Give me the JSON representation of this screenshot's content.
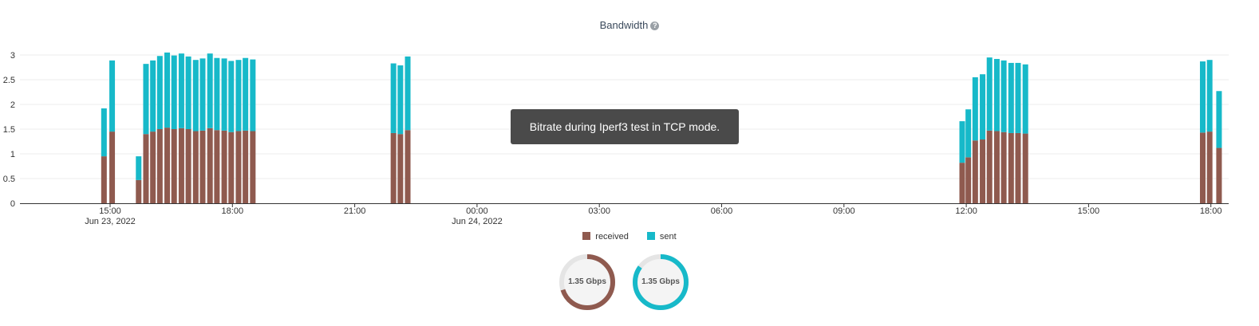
{
  "header": {
    "title": "Bandwidth",
    "help_icon": "question-circle-icon"
  },
  "tooltip": {
    "text": "Bitrate during Iperf3 test in TCP mode."
  },
  "colors": {
    "received": "#8f5a4f",
    "sent": "#17b9c9",
    "gauge_track": "#e5e5e5",
    "gauge_fill": "#f4f4f4"
  },
  "chart_data": {
    "type": "bar",
    "stacked": true,
    "ylim": [
      0,
      3
    ],
    "y_ticks": [
      "0",
      "0.5",
      "1",
      "1.5",
      "2",
      "2.5",
      "3"
    ],
    "x_ticks": [
      {
        "label": "15:00",
        "sub": "Jun 23, 2022"
      },
      {
        "label": "18:00",
        "sub": ""
      },
      {
        "label": "21:00",
        "sub": ""
      },
      {
        "label": "00:00",
        "sub": "Jun 24, 2022"
      },
      {
        "label": "03:00",
        "sub": ""
      },
      {
        "label": "06:00",
        "sub": ""
      },
      {
        "label": "09:00",
        "sub": ""
      },
      {
        "label": "12:00",
        "sub": ""
      },
      {
        "label": "15:00",
        "sub": ""
      },
      {
        "label": "18:00",
        "sub": ""
      }
    ],
    "x_hours": [
      14.85,
      15.05,
      15.7,
      15.88,
      16.05,
      16.22,
      16.4,
      16.57,
      16.75,
      16.92,
      17.1,
      17.27,
      17.45,
      17.62,
      17.8,
      17.97,
      18.15,
      18.32,
      18.5,
      21.95,
      22.12,
      22.3,
      35.9,
      36.05,
      36.22,
      36.4,
      36.57,
      36.75,
      36.92,
      37.1,
      37.27,
      37.45,
      41.8,
      41.97,
      42.2
    ],
    "series": [
      {
        "name": "received",
        "values": [
          0.95,
          1.45,
          0.47,
          1.4,
          1.45,
          1.5,
          1.53,
          1.5,
          1.52,
          1.5,
          1.46,
          1.47,
          1.52,
          1.48,
          1.47,
          1.44,
          1.46,
          1.47,
          1.46,
          1.42,
          1.4,
          1.48,
          0.82,
          0.93,
          1.27,
          1.29,
          1.47,
          1.46,
          1.44,
          1.42,
          1.42,
          1.41,
          1.43,
          1.45,
          1.12
        ]
      },
      {
        "name": "sent",
        "values": [
          0.97,
          1.44,
          0.48,
          1.42,
          1.44,
          1.48,
          1.52,
          1.49,
          1.51,
          1.47,
          1.44,
          1.46,
          1.51,
          1.46,
          1.46,
          1.44,
          1.44,
          1.47,
          1.45,
          1.41,
          1.39,
          1.49,
          0.84,
          0.97,
          1.28,
          1.32,
          1.48,
          1.46,
          1.45,
          1.42,
          1.42,
          1.4,
          1.44,
          1.45,
          1.15
        ]
      }
    ],
    "legend": [
      "received",
      "sent"
    ]
  },
  "gauges": [
    {
      "name": "received",
      "value_text": "1.35 Gbps",
      "fraction": 0.7
    },
    {
      "name": "sent",
      "value_text": "1.35 Gbps",
      "fraction": 0.85
    }
  ]
}
